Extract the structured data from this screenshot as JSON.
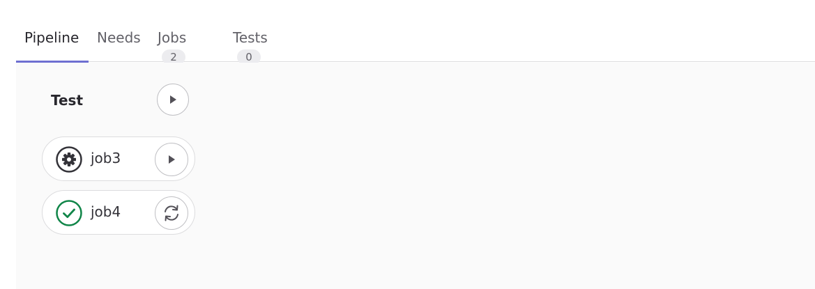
{
  "tabs": [
    {
      "label": "Pipeline",
      "active": true
    },
    {
      "label": "Needs"
    },
    {
      "label": "Jobs",
      "count": "2"
    },
    {
      "label": "Tests",
      "count": "0"
    }
  ],
  "stage": {
    "title": "Test",
    "action_icon": "play-icon",
    "jobs": [
      {
        "name": "job3",
        "status_icon": "gear-icon",
        "status": "manual",
        "action_icon": "play-icon"
      },
      {
        "name": "job4",
        "status_icon": "check-circle-icon",
        "status": "passed",
        "status_color": "#108548",
        "action_icon": "retry-icon"
      }
    ]
  },
  "colors": {
    "active_tab_underline": "#6e6fd1",
    "canvas_background": "#fafafa",
    "success": "#108548"
  }
}
